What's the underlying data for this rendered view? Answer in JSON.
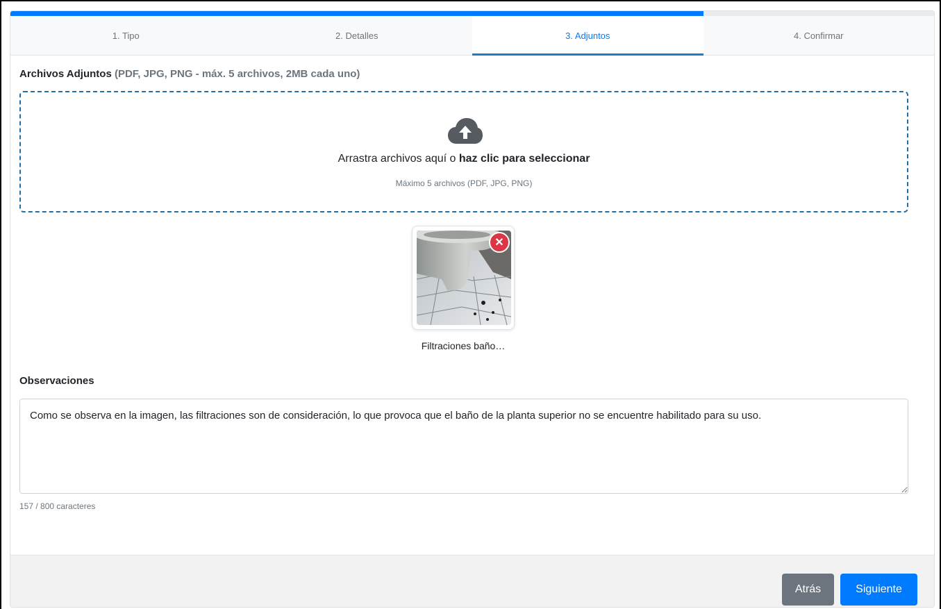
{
  "progress": {
    "percent": 75,
    "color": "#007bff"
  },
  "steps": [
    {
      "label": "1. Tipo",
      "active": false
    },
    {
      "label": "2. Detalles",
      "active": false
    },
    {
      "label": "3. Adjuntos",
      "active": true
    },
    {
      "label": "4. Confirmar",
      "active": false
    }
  ],
  "attachments": {
    "title": "Archivos Adjuntos",
    "hint": "(PDF, JPG, PNG - máx. 5 archivos, 2MB cada uno)",
    "dropzone": {
      "icon": "cloud-upload-icon",
      "text_prefix": "Arrastra archivos aquí o ",
      "text_action": "haz clic para seleccionar",
      "subtext": "Máximo 5 archivos (PDF, JPG, PNG)"
    },
    "files": [
      {
        "name": "Filtraciones baño…",
        "remove_icon": "close-icon"
      }
    ]
  },
  "observations": {
    "label": "Observaciones",
    "value": "Como se observa en la imagen, las filtraciones son de consideración, lo que provoca que el baño de la planta superior no se encuentre habilitado para su uso.",
    "char_count": "157 / 800 caracteres"
  },
  "footer": {
    "back_label": "Atrás",
    "next_label": "Siguiente"
  }
}
